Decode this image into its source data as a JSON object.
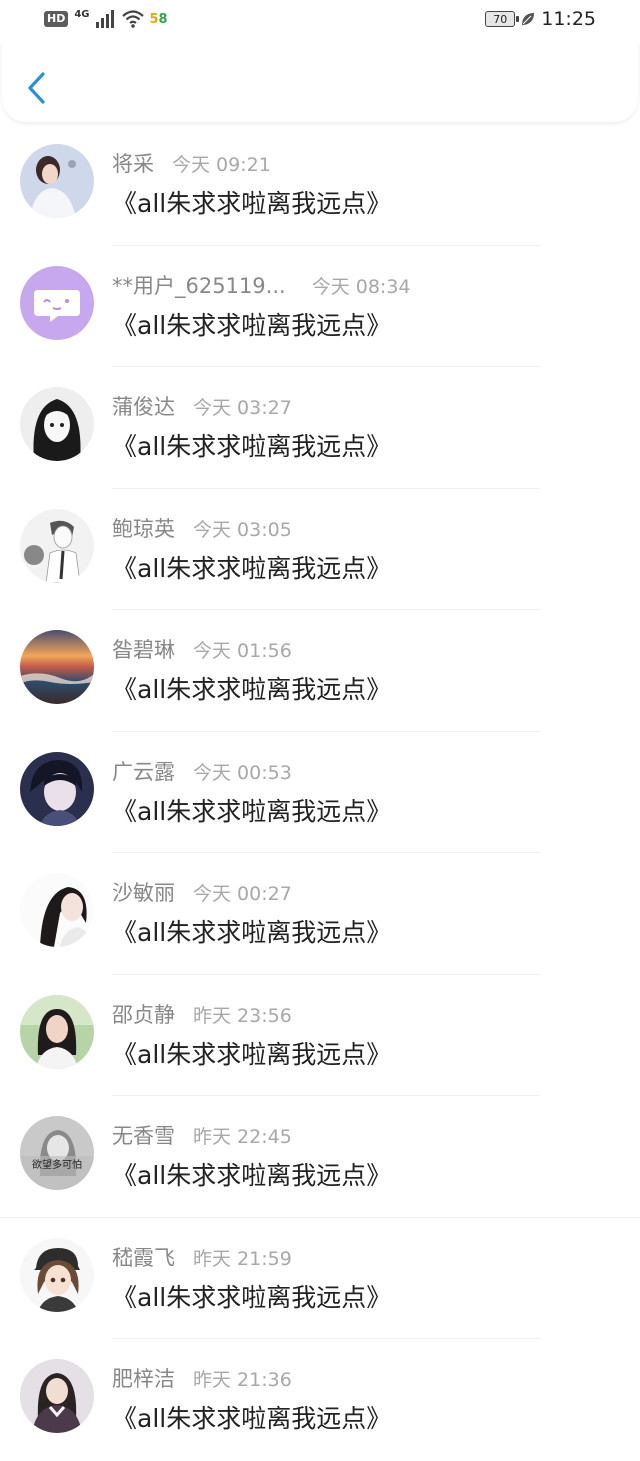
{
  "status_bar": {
    "hd": "HD",
    "network": "4G",
    "speed": "58",
    "battery": "70",
    "time": "11:25"
  },
  "header": {
    "back_icon": "chevron-left-icon",
    "accent": "#2b8fd6"
  },
  "messages": [
    {
      "name": "将采",
      "time": "今天 09:21",
      "text": "《all朱求求啦离我远点》"
    },
    {
      "name": "**用户_625119...",
      "time": "今天 08:34",
      "text": "《all朱求求啦离我远点》"
    },
    {
      "name": "蒲俊达",
      "time": "今天 03:27",
      "text": "《all朱求求啦离我远点》"
    },
    {
      "name": "鲍琼英",
      "time": "今天 03:05",
      "text": "《all朱求求啦离我远点》"
    },
    {
      "name": "昝碧琳",
      "time": "今天 01:56",
      "text": "《all朱求求啦离我远点》"
    },
    {
      "name": "广云露",
      "time": "今天 00:53",
      "text": "《all朱求求啦离我远点》"
    },
    {
      "name": "沙敏丽",
      "time": "今天 00:27",
      "text": "《all朱求求啦离我远点》"
    },
    {
      "name": "邵贞静",
      "time": "昨天 23:56",
      "text": "《all朱求求啦离我远点》"
    },
    {
      "name": "无香雪",
      "time": "昨天 22:45",
      "text": "《all朱求求啦离我远点》",
      "avatar_text": "欲望多可怕"
    },
    {
      "name": "嵇霞飞",
      "time": "昨天 21:59",
      "text": "《all朱求求啦离我远点》"
    },
    {
      "name": "肥梓洁",
      "time": "昨天 21:36",
      "text": "《all朱求求啦离我远点》"
    }
  ]
}
